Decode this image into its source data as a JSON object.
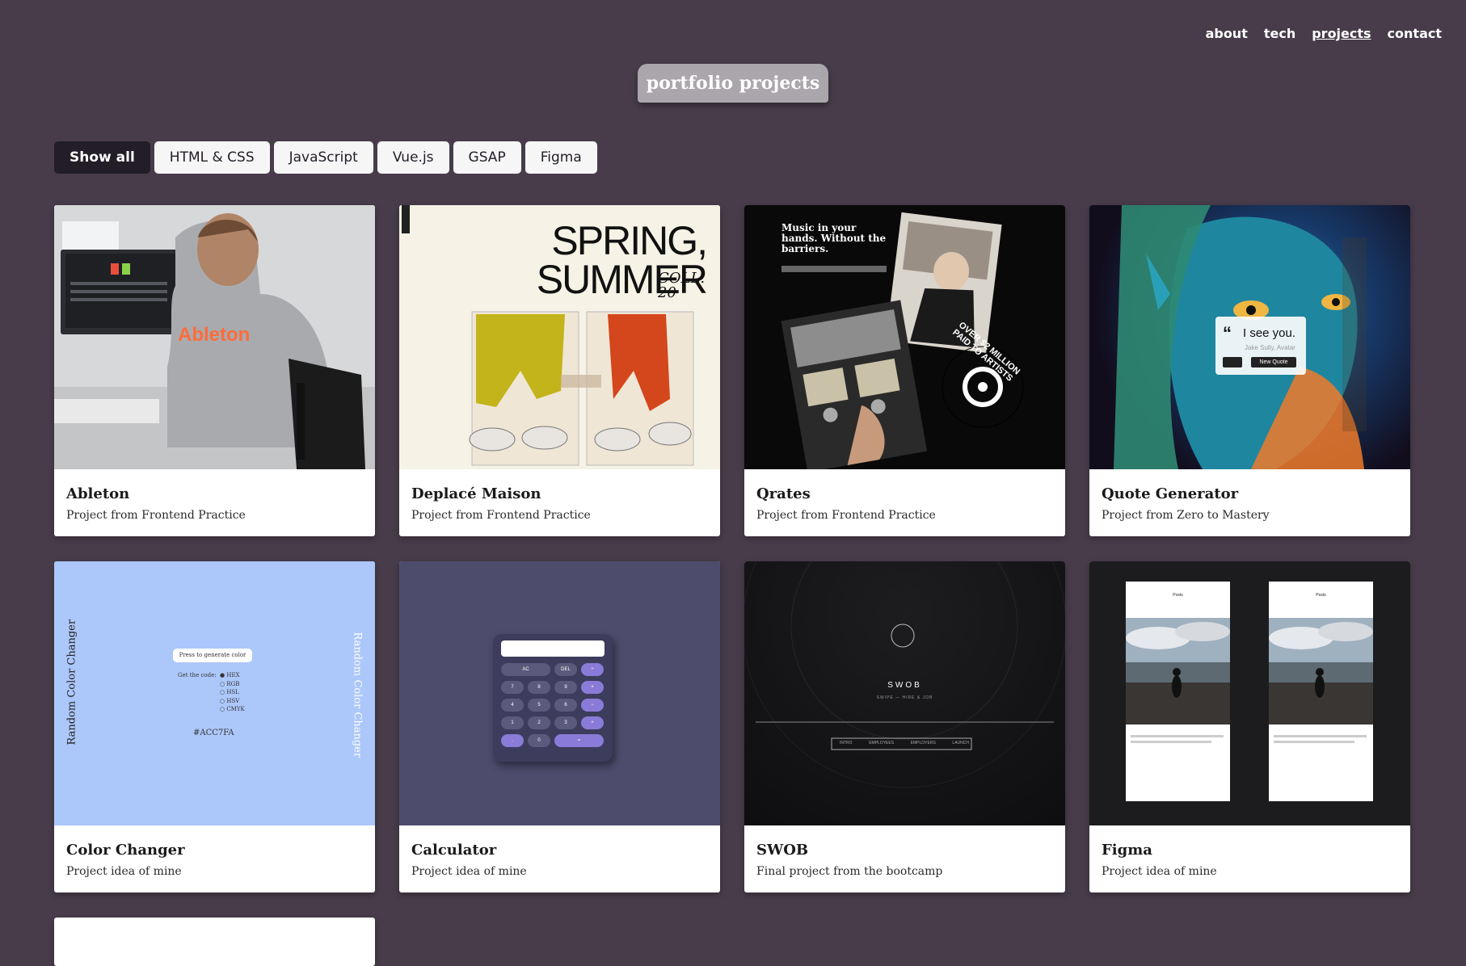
{
  "nav": [
    {
      "label": "about",
      "active": false
    },
    {
      "label": "tech",
      "active": false
    },
    {
      "label": "projects",
      "active": true
    },
    {
      "label": "contact",
      "active": false
    }
  ],
  "page_title": "portfolio projects",
  "filters": [
    {
      "label": "Show all",
      "active": true
    },
    {
      "label": "HTML & CSS",
      "active": false
    },
    {
      "label": "JavaScript",
      "active": false
    },
    {
      "label": "Vue.js",
      "active": false
    },
    {
      "label": "GSAP",
      "active": false
    },
    {
      "label": "Figma",
      "active": false
    }
  ],
  "projects": [
    {
      "title": "Ableton",
      "subtitle": "Project from Frontend Practice",
      "thumb_text": "Ableton"
    },
    {
      "title": "Deplacé Maison",
      "subtitle": "Project from Frontend Practice",
      "thumb_text": "SPRING, SUMMER",
      "thumb_text_2": "COLL. 20"
    },
    {
      "title": "Qrates",
      "subtitle": "Project from Frontend Practice",
      "thumb_text": "Music in your hands. Without the barriers.",
      "thumb_text_2": "OVER $2 MILLION PAID TO ARTISTS"
    },
    {
      "title": "Quote Generator",
      "subtitle": "Project from Zero to Mastery",
      "thumb_text": "I see you.",
      "thumb_text_2": "Jake Sully, Avatar",
      "thumb_text_3": "New Quote"
    },
    {
      "title": "Color Changer",
      "subtitle": "Project idea of mine",
      "thumb_text": "Random Color Changer",
      "thumb_text_2": "Press to generate color",
      "thumb_text_3": "#ACC7FA",
      "thumb_text_4": "Get the code:",
      "options": [
        "HEX",
        "RGB",
        "HSL",
        "HSV",
        "CMYK"
      ]
    },
    {
      "title": "Calculator",
      "subtitle": "Project idea of mine",
      "keys": [
        "AC",
        "DEL",
        "÷",
        "7",
        "8",
        "9",
        "×",
        "4",
        "5",
        "6",
        "−",
        "1",
        "2",
        "3",
        "+",
        ".",
        "0",
        "="
      ]
    },
    {
      "title": "SWOB",
      "subtitle": "Final project from the bootcamp",
      "thumb_text": "SWOB",
      "thumb_text_2": "SWIPE — HIRE & JOB",
      "menu": [
        "INTRO",
        "EMPLOYEES",
        "EMPLOYERS",
        "LAUNCH"
      ]
    },
    {
      "title": "Figma",
      "subtitle": "Project idea of mine",
      "thumb_text": "Posts"
    }
  ],
  "colors": {
    "background": "#483c4b",
    "title_chip": "#aaa6ab",
    "filter_active": "#221d27",
    "accent_ableton": "#ff6c3b",
    "color_changer": "#ACC7FA",
    "calculator_key": "#8b7bd8"
  }
}
